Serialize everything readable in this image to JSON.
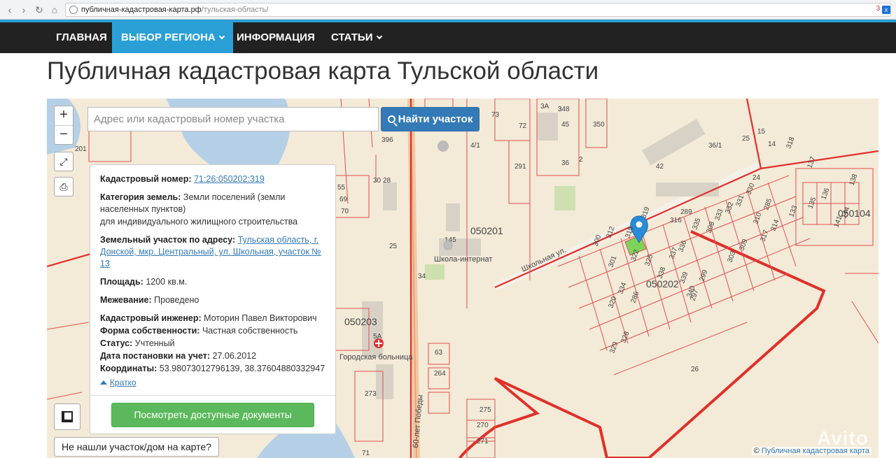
{
  "browser": {
    "url_domain": "публичная-кадастровая-карта.рф",
    "url_path": "/тульская-область/",
    "ext_count": "3"
  },
  "nav": {
    "items": [
      {
        "label": "ГЛАВНАЯ"
      },
      {
        "label": "ВЫБОР РЕГИОНА"
      },
      {
        "label": "ИНФОРМАЦИЯ"
      },
      {
        "label": "СТАТЬИ"
      }
    ]
  },
  "page": {
    "title": "Публичная кадастровая карта Тульской области"
  },
  "map": {
    "zoom_in": "+",
    "zoom_out": "−",
    "search": {
      "placeholder": "Адрес или кадастровый номер участка",
      "button_label": "Найти участок"
    },
    "quarters": [
      "050201",
      "050202",
      "050203",
      "050104"
    ],
    "places": [
      "Школа-интернат",
      "Городская больница",
      "Школьная ул.",
      "60-лет Победы"
    ],
    "parcel_numbers": [
      "348",
      "45",
      "350",
      "72",
      "3А",
      "4/1",
      "73",
      "291",
      "36",
      "2",
      "42",
      "289",
      "316",
      "319",
      "312",
      "300",
      "301",
      "322",
      "325",
      "308",
      "335",
      "336",
      "337",
      "338",
      "339",
      "340",
      "330",
      "331",
      "332",
      "333",
      "334",
      "315",
      "317",
      "320",
      "329",
      "328",
      "285",
      "286",
      "297",
      "299",
      "303",
      "309",
      "310",
      "314",
      "318",
      "133",
      "135",
      "136",
      "137",
      "138",
      "141",
      "144",
      "145",
      "25",
      "34",
      "5А",
      "63",
      "264",
      "275",
      "270",
      "271",
      "273",
      "36/1",
      "24",
      "25",
      "15",
      "14",
      "201",
      "396",
      "28",
      "30",
      "55",
      "69",
      "70",
      "71",
      "26",
      "3"
    ],
    "info": {
      "cadastral_label": "Кадастровый номер:",
      "cadastral_value": "71:26:050202:319",
      "category_label": "Категория земель:",
      "category_value": "Земли поселений (земли населенных пунктов)",
      "use_value": "для индивидуального жилищного строительства",
      "address_label": "Земельный участок по адресу:",
      "address_value": "Тульская область, г. Донской, мкр. Центральный, ул. Школьная, участок № 13",
      "area_label": "Площадь:",
      "area_value": "1200 кв.м.",
      "survey_label": "Межевание:",
      "survey_value": "Проведено",
      "engineer_label": "Кадастровый инженер:",
      "engineer_value": "Моторин Павел Викторович",
      "ownership_label": "Форма собственности:",
      "ownership_value": "Частная собственность",
      "status_label": "Статус:",
      "status_value": "Учтенный",
      "date_label": "Дата постановки на учет:",
      "date_value": "27.06.2012",
      "coords_label": "Координаты:",
      "coords_value": "53.98073012796139, 38.37604880332947",
      "collapse_label": "Кратко",
      "docs_button": "Посмотреть доступные документы"
    },
    "not_found_button": "Не нашли участок/дом на карте?",
    "attribution_symbol": "©",
    "attribution": "Публичная кадастровая карта",
    "watermark": "Avito"
  }
}
